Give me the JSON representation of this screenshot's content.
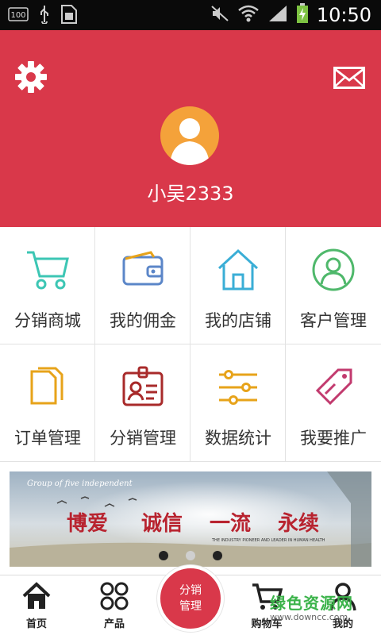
{
  "status_bar": {
    "left_icons": [
      "battery-100-icon",
      "usb-icon",
      "sim-icon"
    ],
    "battery_text": "100",
    "right_icons": [
      "mute-icon",
      "wifi-icon",
      "signal-icon",
      "battery-charging-icon"
    ],
    "time": "10:50"
  },
  "header": {
    "settings_icon": "gear-icon",
    "message_icon": "mail-icon",
    "username": "小吴2333",
    "bg_color": "#d9384a"
  },
  "grid": [
    {
      "label": "分销商城",
      "icon": "cart-icon",
      "color": "#3cc6b4"
    },
    {
      "label": "我的佣金",
      "icon": "wallet-icon",
      "color": "#5b86c8"
    },
    {
      "label": "我的店铺",
      "icon": "home-icon",
      "color": "#3aaed6"
    },
    {
      "label": "客户管理",
      "icon": "user-circle-icon",
      "color": "#4fb86b"
    },
    {
      "label": "订单管理",
      "icon": "documents-icon",
      "color": "#e7a31a"
    },
    {
      "label": "分销管理",
      "icon": "id-badge-icon",
      "color": "#a82a2a"
    },
    {
      "label": "数据统计",
      "icon": "sliders-icon",
      "color": "#e7a31a"
    },
    {
      "label": "我要推广",
      "icon": "tag-icon",
      "color": "#c23a6e"
    }
  ],
  "banner": {
    "script_text": "Group of five independent",
    "slogan": [
      "博爱",
      "诚信",
      "一流",
      "永续"
    ],
    "tagline": "THE INDUSTRY PIONEER AND LEADER IN HUMAN HEALTH",
    "active_dot": 1,
    "dot_count": 3
  },
  "bottom_nav": {
    "home_label": "首页",
    "products_label": "产品",
    "center_label_1": "分销",
    "center_label_2": "管理",
    "cart_label": "购物车",
    "mine_label": "我的"
  },
  "watermark": {
    "title": "绿色资源网",
    "url": "www.downcc.com"
  }
}
